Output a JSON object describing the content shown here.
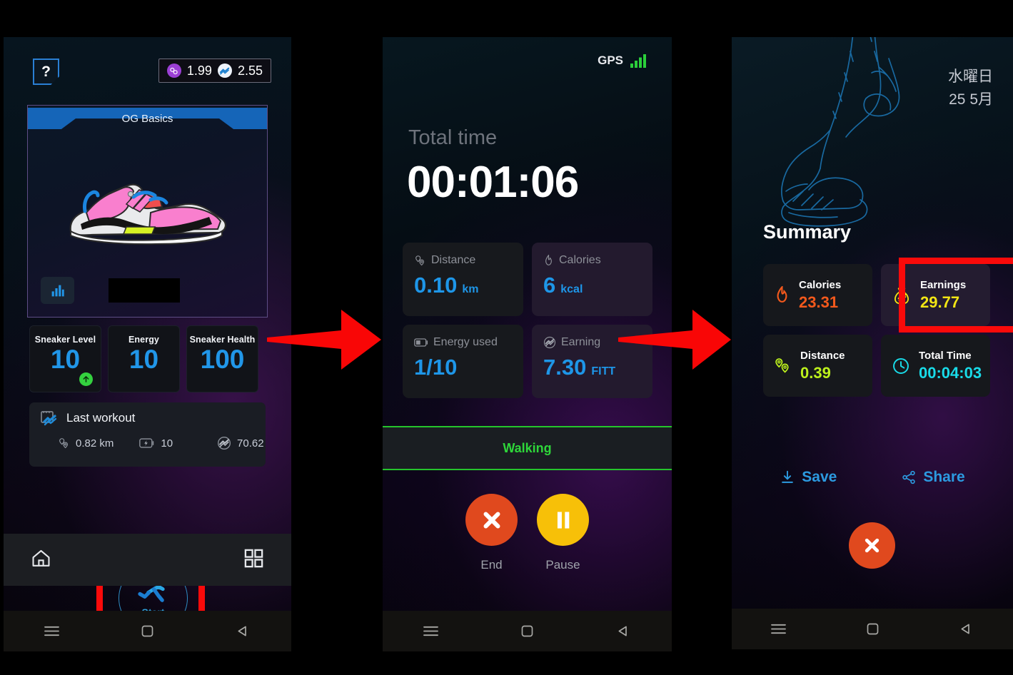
{
  "meta": {
    "accent_blue": "#2196e8",
    "red_highlight": "#fa0a0a",
    "green": "#2ed63a",
    "orange": "#e0491e",
    "yellow": "#f7c008"
  },
  "panel1": {
    "logo": "?",
    "wallet": [
      {
        "icon": "gst-coin-icon",
        "value": "1.99",
        "color": "#9b3fd4"
      },
      {
        "icon": "fitt-coin-icon",
        "value": "2.55",
        "color": "#eef3fb"
      }
    ],
    "sneaker": {
      "name": "OG Basics",
      "chart_icon": "bar-chart-icon"
    },
    "stats": [
      {
        "label": "Sneaker Level",
        "value": "10",
        "badge": "up-arrow-icon"
      },
      {
        "label": "Energy",
        "value": "10",
        "badge": ""
      },
      {
        "label": "Sneaker Health",
        "value": "100",
        "badge": ""
      }
    ],
    "last_workout": {
      "title": "Last workout",
      "icon": "calendar-workout-icon",
      "metrics": [
        {
          "icon": "location-pin-icon",
          "value": "0.82 km"
        },
        {
          "icon": "battery-bolt-icon",
          "value": "10"
        },
        {
          "icon": "fitt-token-icon",
          "value": "70.62"
        }
      ]
    },
    "start_button": {
      "label": "Start",
      "icon": "running-person-icon"
    },
    "nav": [
      {
        "icon": "home-icon",
        "name": "home"
      },
      {
        "icon": "grid-apps-icon",
        "name": "apps"
      }
    ]
  },
  "panel2": {
    "gps": {
      "label": "GPS",
      "icon": "signal-bars-icon"
    },
    "total_time_label": "Total time",
    "total_time_value": "00:01:06",
    "cards": [
      {
        "icon": "location-pin-icon",
        "label": "Distance",
        "value": "0.10",
        "unit": "km",
        "style": "dark"
      },
      {
        "icon": "flame-icon",
        "label": "Calories",
        "value": "6",
        "unit": "kcal",
        "style": "purp"
      },
      {
        "icon": "battery-icon",
        "label": "Energy used",
        "value": "1/10",
        "unit": "",
        "style": "dark"
      },
      {
        "icon": "fitt-token-icon",
        "label": "Earning",
        "value": "7.30",
        "unit": "FITT",
        "style": "purp"
      }
    ],
    "activity_mode": "Walking",
    "controls": [
      {
        "icon": "close-x-icon",
        "label": "End",
        "style": "red"
      },
      {
        "icon": "pause-icon",
        "label": "Pause",
        "style": "yel"
      }
    ]
  },
  "panel3": {
    "date_line1": "水曜日",
    "date_line2": "25 5月",
    "title": "Summary",
    "cards": [
      {
        "icon": "flame-icon",
        "label": "Calories",
        "value": "23.31",
        "color": "#f4591c",
        "style": "dark",
        "highlighted": false
      },
      {
        "icon": "money-bag-icon",
        "label": "Earnings",
        "value": "29.77",
        "color": "#f2e514",
        "style": "purp",
        "highlighted": true
      },
      {
        "icon": "location-pin-icon",
        "label": "Distance",
        "value": "0.39",
        "color": "#bdf11c",
        "style": "dark",
        "highlighted": false
      },
      {
        "icon": "clock-icon",
        "label": "Total Time",
        "value": "00:04:03",
        "color": "#19dbe8",
        "style": "dark",
        "highlighted": false
      }
    ],
    "actions": [
      {
        "icon": "download-icon",
        "label": "Save"
      },
      {
        "icon": "share-icon",
        "label": "Share"
      }
    ],
    "close_button": {
      "icon": "close-x-icon"
    }
  },
  "android_nav": {
    "menu": "menu-icon",
    "home": "square-home-icon",
    "back": "back-triangle-icon"
  },
  "arrows": [
    {
      "name": "flow-arrow-1"
    },
    {
      "name": "flow-arrow-2"
    }
  ]
}
